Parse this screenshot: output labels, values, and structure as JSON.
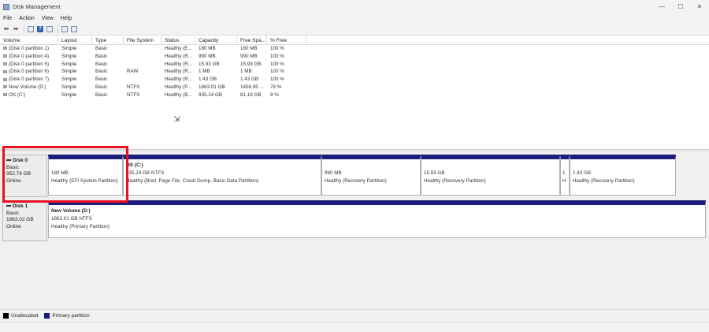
{
  "window": {
    "title": "Disk Management",
    "minimize_glyph": "—",
    "maximize_glyph": "☐",
    "close_glyph": "✕"
  },
  "menu": [
    "File",
    "Action",
    "View",
    "Help"
  ],
  "toolbar": {
    "icons": [
      "back-icon",
      "forward-icon",
      "properties-icon",
      "help-icon",
      "rescan-icon",
      "settings-icon"
    ],
    "back_glyph": "⬅",
    "forward_glyph": "➡",
    "help_glyph": "?"
  },
  "volume_list": {
    "columns": [
      "Volume",
      "Layout",
      "Type",
      "File System",
      "Status",
      "Capacity",
      "Free Spa...",
      "% Free"
    ],
    "rows": [
      [
        "(Disk 0 partition 1)",
        "Simple",
        "Basic",
        "",
        "Healthy (E...",
        "180 MB",
        "180 MB",
        "100 %"
      ],
      [
        "(Disk 0 partition 4)",
        "Simple",
        "Basic",
        "",
        "Healthy (R...",
        "990 MB",
        "990 MB",
        "100 %"
      ],
      [
        "(Disk 0 partition 5)",
        "Simple",
        "Basic",
        "",
        "Healthy (R...",
        "15.93 GB",
        "15.93 GB",
        "100 %"
      ],
      [
        "(Disk 0 partition 6)",
        "Simple",
        "Basic",
        "RAW",
        "Healthy (R...",
        "1 MB",
        "1 MB",
        "100 %"
      ],
      [
        "(Disk 0 partition 7)",
        "Simple",
        "Basic",
        "",
        "Healthy (R...",
        "1.43 GB",
        "1.43 GB",
        "100 %"
      ],
      [
        "New Volume (D:)",
        "Simple",
        "Basic",
        "NTFS",
        "Healthy (P...",
        "1863.01 GB",
        "1456.95 ...",
        "78 %"
      ],
      [
        "OS (C:)",
        "Simple",
        "Basic",
        "NTFS",
        "Healthy (B...",
        "935.24 GB",
        "81.19 GB",
        "9 %"
      ]
    ]
  },
  "disks": [
    {
      "name": "Disk 0",
      "type": "Basic",
      "size": "952.74 GB",
      "status": "Online",
      "partitions": [
        {
          "name": "",
          "size": "180 MB",
          "status": "Healthy (EFI System Partition)"
        },
        {
          "name": "OS (C:)",
          "size": "935.24 GB NTFS",
          "status": "Healthy (Boot, Page File, Crash Dump, Basic Data Partition)"
        },
        {
          "name": "",
          "size": "990 MB",
          "status": "Healthy (Recovery Partition)"
        },
        {
          "name": "",
          "size": "15.93 GB",
          "status": "Healthy (Recovery Partition)"
        },
        {
          "name": "",
          "size": "1",
          "status": "H"
        },
        {
          "name": "",
          "size": "1.43 GB",
          "status": "Healthy (Recovery Partition)"
        }
      ]
    },
    {
      "name": "Disk 1",
      "type": "Basic",
      "size": "1863.02 GB",
      "status": "Online",
      "partitions": [
        {
          "name": "New Volume (D:)",
          "size": "1863.01 GB NTFS",
          "status": "Healthy (Primary Partition)"
        }
      ]
    }
  ],
  "legend": [
    {
      "label": "Unallocated",
      "color": "#000000"
    },
    {
      "label": "Primary partition",
      "color": "#1c1c7c"
    }
  ],
  "colors": {
    "highlight": "#e81123",
    "partition_header": "#1c1c7c"
  }
}
